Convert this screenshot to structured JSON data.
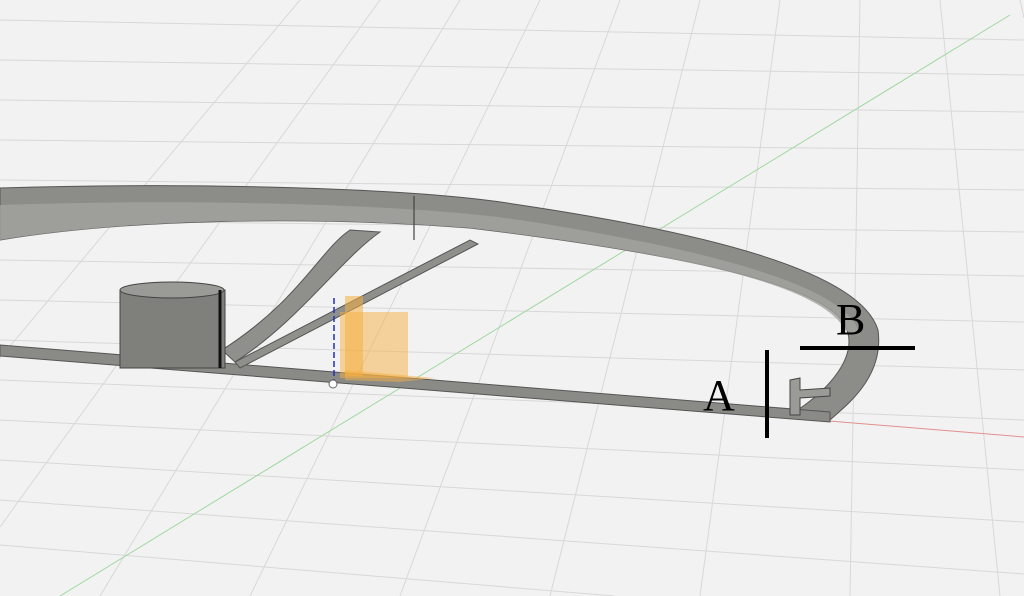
{
  "viewport": {
    "background": "#f2f2f2",
    "grid_color": "#d6d6d6",
    "x_axis_color": "#e08080",
    "y_axis_color": "#8fd08f",
    "z_axis_color": "#2030c0",
    "model_color": "#8c8c88",
    "plane_color": "#f5b042"
  },
  "annotations": {
    "a_label": "A",
    "b_label": "B"
  }
}
